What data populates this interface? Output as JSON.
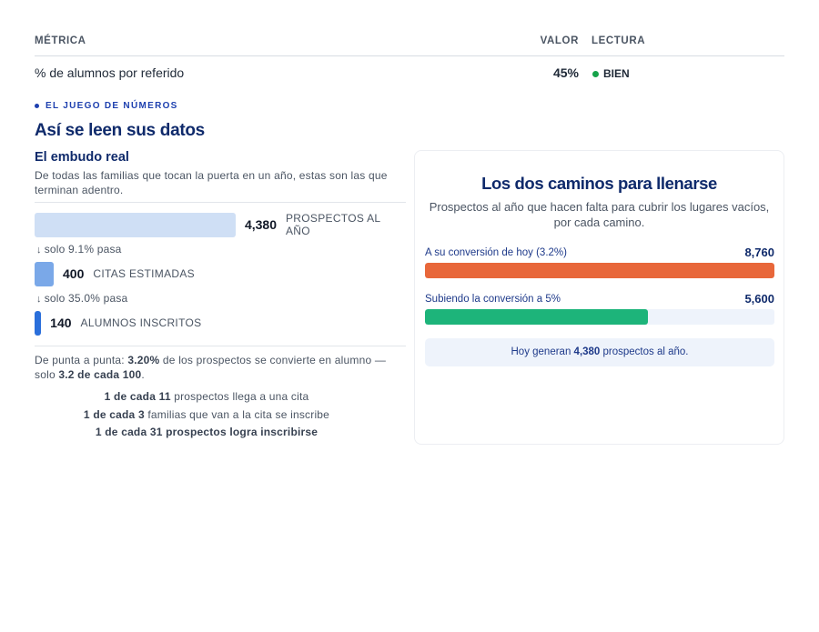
{
  "table": {
    "headers": {
      "metric": "MÉTRICA",
      "value": "VALOR",
      "reading": "LECTURA"
    },
    "rows": [
      {
        "metric": "% de alumnos por referido",
        "value": "45%",
        "reading": "BIEN",
        "status_color": "#16a34a"
      }
    ]
  },
  "eyebrow": "EL JUEGO DE NÚMEROS",
  "section_title": "Así se leen sus datos",
  "funnel": {
    "title": "El embudo real",
    "description": "De todas las familias que tocan la puerta en un año, estas son las que terminan adentro.",
    "stages": [
      {
        "value": "4,380",
        "label": "PROSPECTOS AL AÑO",
        "color": "#cfdff5",
        "fraction": 1.0
      },
      {
        "value": "400",
        "label": "CITAS ESTIMADAS",
        "color": "#7aa8e8",
        "fraction": 0.0913
      },
      {
        "value": "140",
        "label": "ALUMNOS INSCRITOS",
        "color": "#2a6fdb",
        "fraction": 0.032
      }
    ],
    "passes": [
      "solo 9.1% pasa",
      "solo 35.0% pasa"
    ],
    "summary": {
      "prefix": "De punta a punta: ",
      "pct": "3.20%",
      "middle": " de los prospectos se convierte en alumno — solo ",
      "strong": "3.2 de cada 100",
      "suffix": "."
    },
    "ratios": [
      {
        "strong": "1 de cada 11",
        "rest": " prospectos llega a una cita"
      },
      {
        "strong": "1 de cada 3",
        "rest": " familias que van a la cita se inscribe"
      },
      {
        "strong": "1 de cada 31 prospectos logra inscribirse",
        "rest": ""
      }
    ]
  },
  "paths_card": {
    "title": "Los dos caminos para llenarse",
    "subtitle": "Prospectos al año que hacen falta para cubrir los lugares vacíos, por cada camino.",
    "paths": [
      {
        "label": "A su conversión de hoy (3.2%)",
        "value": "8,760",
        "fraction": 1.0,
        "color": "#e8673a"
      },
      {
        "label": "Subiendo la conversión a 5%",
        "value": "5,600",
        "fraction": 0.639,
        "color": "#1db47a"
      }
    ],
    "note": {
      "prefix": "Hoy generan ",
      "strong": "4,380",
      "suffix": " prospectos al año."
    }
  }
}
